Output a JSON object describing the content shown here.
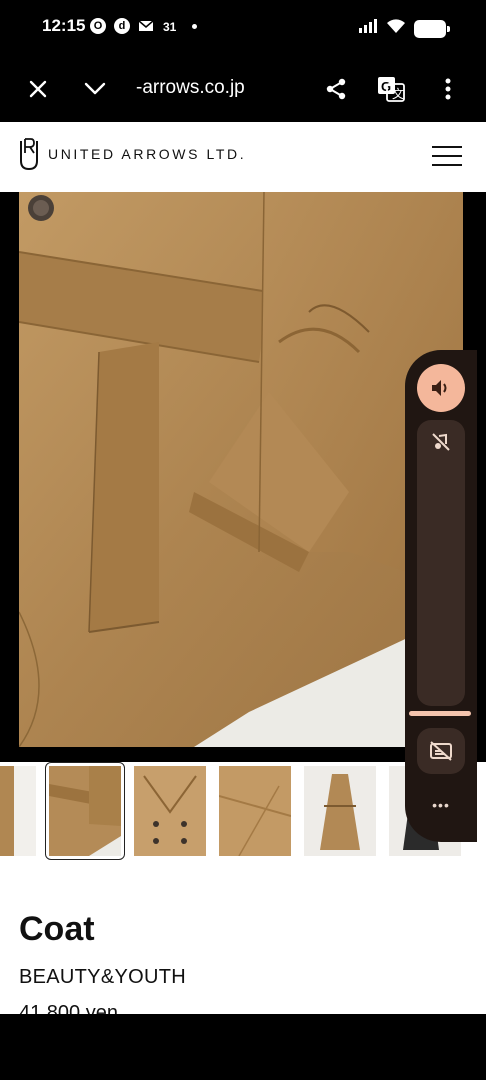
{
  "status_bar": {
    "time": "12:15",
    "icons_left": [
      "opera-icon",
      "d-app-icon",
      "mail-icon",
      "calendar-icon"
    ],
    "icons_right": [
      "signal-icon",
      "wifi-icon",
      "battery-icon"
    ]
  },
  "browser": {
    "url": "-arrows.co.jp",
    "buttons": [
      "close-icon",
      "chevron-down-icon",
      "share-icon",
      "translate-icon",
      "more-vert-icon"
    ]
  },
  "site": {
    "logo_text": "UNITED ARROWS LTD."
  },
  "product": {
    "title": "Coat",
    "brand": "BEAUTY&YOUTH",
    "price": "41,800 yen"
  },
  "thumbnails": [
    {
      "name": "thumb-0",
      "selected": false
    },
    {
      "name": "thumb-1",
      "selected": true
    },
    {
      "name": "thumb-2",
      "selected": false
    },
    {
      "name": "thumb-3",
      "selected": false
    },
    {
      "name": "thumb-4",
      "selected": false
    },
    {
      "name": "thumb-5",
      "selected": false
    }
  ],
  "volume_panel": {
    "more_label": "•••",
    "accent": "#f4b79b"
  }
}
